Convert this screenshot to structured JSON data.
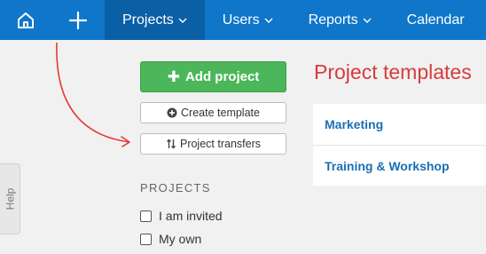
{
  "nav": {
    "home_icon": "home-icon",
    "add_icon": "plus-icon",
    "items": [
      {
        "label": "Projects",
        "dropdown": true,
        "active": true
      },
      {
        "label": "Users",
        "dropdown": true
      },
      {
        "label": "Reports",
        "dropdown": true
      },
      {
        "label": "Calendar",
        "dropdown": false
      }
    ]
  },
  "help_tab": {
    "label": "Help"
  },
  "actions": {
    "add_project": "Add project",
    "create_template": "Create template",
    "project_transfers": "Project transfers"
  },
  "projects_filter": {
    "heading": "PROJECTS",
    "options": [
      {
        "label": "I am invited",
        "checked": false
      },
      {
        "label": "My own",
        "checked": false
      }
    ]
  },
  "templates": {
    "title": "Project templates",
    "items": [
      "Marketing",
      "Training & Workshop"
    ]
  },
  "colors": {
    "nav_bg": "#0f76c9",
    "nav_active": "#0a5fa5",
    "add_button": "#4cb65a",
    "templates_title": "#d83b3b",
    "template_link": "#1a6fb5",
    "annotation_arrow": "#e53935"
  }
}
